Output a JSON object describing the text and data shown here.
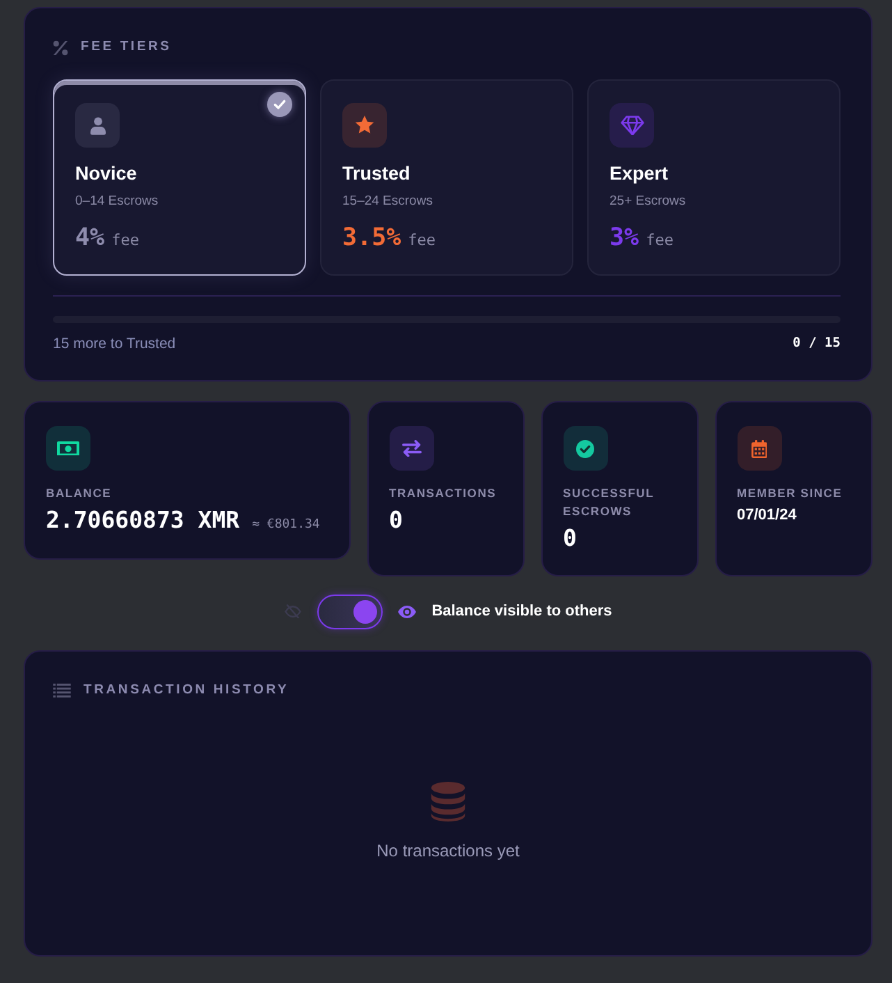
{
  "fee_tiers": {
    "title": "FEE TIERS",
    "tiers": [
      {
        "kind": "novice",
        "name": "Novice",
        "range": "0–14 Escrows",
        "fee": "4%",
        "fee_unit": "fee",
        "color": "#8e8cad",
        "selected": true
      },
      {
        "kind": "trusted",
        "name": "Trusted",
        "range": "15–24 Escrows",
        "fee": "3.5%",
        "fee_unit": "fee",
        "color": "#f26b36",
        "selected": false
      },
      {
        "kind": "expert",
        "name": "Expert",
        "range": "25+ Escrows",
        "fee": "3%",
        "fee_unit": "fee",
        "color": "#7c3aed",
        "selected": false
      }
    ],
    "progress": {
      "level": 0,
      "caption": "15 more to Trusted",
      "count": "0 / 15"
    }
  },
  "stats": [
    {
      "kind": "balance",
      "label": "BALANCE",
      "value": "2.70660873 XMR",
      "fiat": "≈ €801.34",
      "color": "#10d9a0"
    },
    {
      "kind": "transactions",
      "label": "TRANSACTIONS",
      "value": "0",
      "color": "#8b5cf6"
    },
    {
      "kind": "escrows",
      "label": "SUCCESSFUL ESCROWS",
      "value": "0",
      "color": "#14c9a0"
    },
    {
      "kind": "member",
      "label": "MEMBER SINCE",
      "value": "07/01/24",
      "color": "#f0642d"
    }
  ],
  "balance_visibility": {
    "on": true,
    "label": "Balance visible to others"
  },
  "history": {
    "title": "TRANSACTION HISTORY",
    "empty_text": "No transactions yet"
  }
}
